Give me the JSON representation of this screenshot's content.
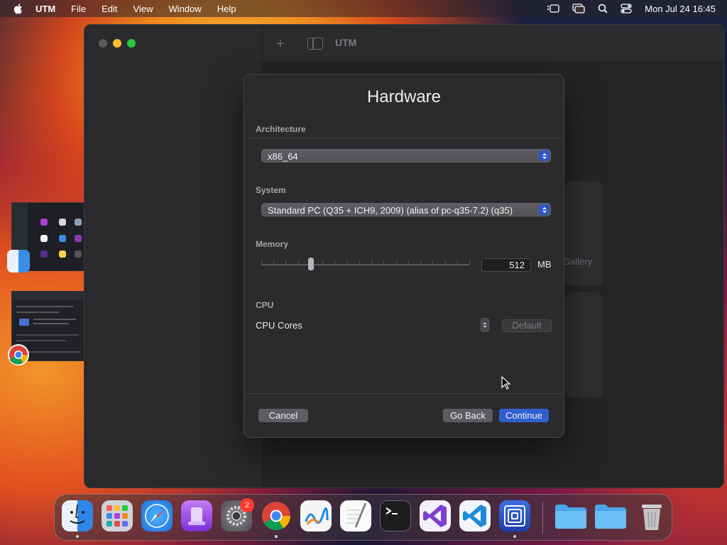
{
  "menubar": {
    "app_name": "UTM",
    "items": [
      "File",
      "Edit",
      "View",
      "Window",
      "Help"
    ],
    "datetime": "Mon Jul 24  16:45"
  },
  "window": {
    "title": "UTM",
    "gallery_text": "Gallery"
  },
  "dialog": {
    "title": "Hardware",
    "architecture": {
      "label": "Architecture",
      "value": "x86_64"
    },
    "system": {
      "label": "System",
      "value": "Standard PC (Q35 + ICH9, 2009) (alias of pc-q35-7.2) (q35)"
    },
    "memory": {
      "label": "Memory",
      "value": "512",
      "unit": "MB",
      "slider_fraction": 0.24
    },
    "cpu": {
      "label": "CPU",
      "cores_label": "CPU Cores",
      "default_label": "Default"
    },
    "buttons": {
      "cancel": "Cancel",
      "go_back": "Go Back",
      "continue": "Continue"
    }
  },
  "dock": {
    "apps": [
      "finder",
      "launchpad",
      "safari",
      "podcasts",
      "system-settings",
      "chrome",
      "freeform",
      "textedit",
      "terminal",
      "visual-studio",
      "vscode",
      "utm",
      "folder",
      "folder",
      "trash"
    ],
    "settings_badge": "2"
  },
  "colors": {
    "accent": "#2f5fd0",
    "dialog_bg": "#2b2b2d"
  }
}
